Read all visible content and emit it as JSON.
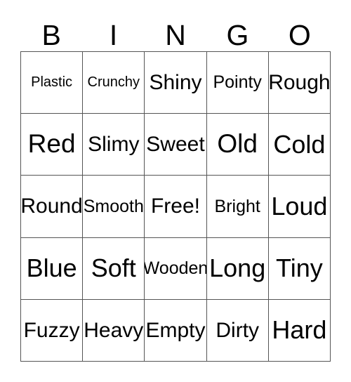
{
  "header": {
    "letters": [
      "B",
      "I",
      "N",
      "G",
      "O"
    ]
  },
  "grid": {
    "columns": 5,
    "rows": 5,
    "free_space": "Free!",
    "cells": [
      "Plastic",
      "Crunchy",
      "Shiny",
      "Pointy",
      "Rough",
      "Red",
      "Slimy",
      "Sweet",
      "Old",
      "Cold",
      "Round",
      "Smooth",
      "Free!",
      "Bright",
      "Loud",
      "Blue",
      "Soft",
      "Wooden",
      "Long",
      "Tiny",
      "Fuzzy",
      "Heavy",
      "Empty",
      "Dirty",
      "Hard"
    ]
  },
  "colors": {
    "background": "#ffffff",
    "text": "#000000",
    "grid_line": "#555555"
  }
}
